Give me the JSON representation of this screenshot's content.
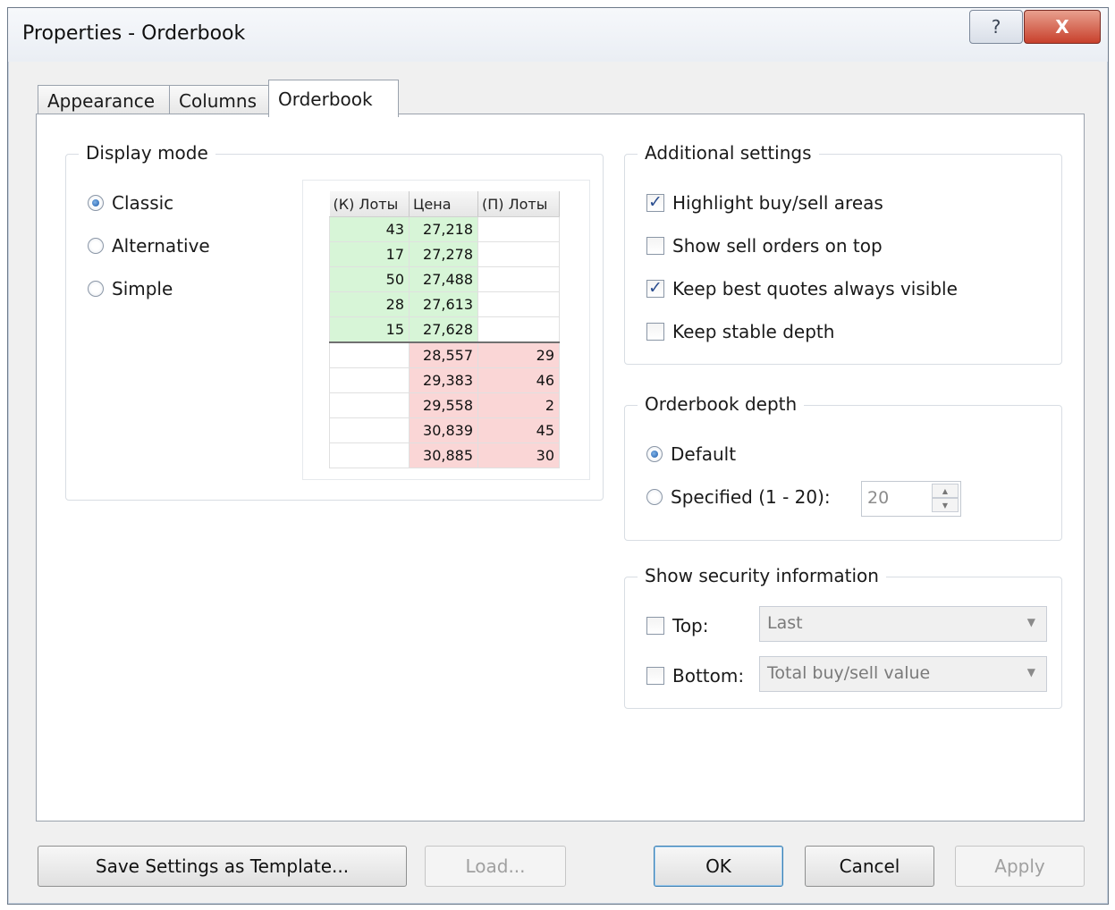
{
  "window": {
    "title": "Properties - Orderbook",
    "help_glyph": "?",
    "close_glyph": "X"
  },
  "tabs": [
    {
      "label": "Appearance",
      "active": false
    },
    {
      "label": "Columns",
      "active": false
    },
    {
      "label": "Orderbook",
      "active": true
    }
  ],
  "display_mode": {
    "title": "Display mode",
    "options": [
      {
        "label": "Classic",
        "selected": true
      },
      {
        "label": "Alternative",
        "selected": false
      },
      {
        "label": "Simple",
        "selected": false
      }
    ],
    "preview": {
      "headers": [
        "(К) Лоты",
        "Цена",
        "(П) Лоты"
      ],
      "buy_rows": [
        [
          "43",
          "27,218",
          ""
        ],
        [
          "17",
          "27,278",
          ""
        ],
        [
          "50",
          "27,488",
          ""
        ],
        [
          "28",
          "27,613",
          ""
        ],
        [
          "15",
          "27,628",
          ""
        ]
      ],
      "sell_rows": [
        [
          "",
          "28,557",
          "29"
        ],
        [
          "",
          "29,383",
          "46"
        ],
        [
          "",
          "29,558",
          "2"
        ],
        [
          "",
          "30,839",
          "45"
        ],
        [
          "",
          "30,885",
          "30"
        ]
      ],
      "buy_color": "#d7f5d7",
      "sell_color": "#fad6d6"
    }
  },
  "additional": {
    "title": "Additional settings",
    "options": [
      {
        "label": "Highlight buy/sell areas",
        "checked": true
      },
      {
        "label": "Show sell orders on top",
        "checked": false
      },
      {
        "label": "Keep best quotes always visible",
        "checked": true
      },
      {
        "label": "Keep stable depth",
        "checked": false
      }
    ]
  },
  "depth": {
    "title": "Orderbook depth",
    "default_label": "Default",
    "default_selected": true,
    "specified_label": "Specified (1 - 20):",
    "specified_selected": false,
    "value": "20"
  },
  "security": {
    "title": "Show security information",
    "top_label": "Top:",
    "top_checked": false,
    "top_value": "Last",
    "bottom_label": "Bottom:",
    "bottom_checked": false,
    "bottom_value": "Total buy/sell value"
  },
  "buttons": {
    "save_template": "Save Settings as Template...",
    "load": "Load...",
    "ok": "OK",
    "cancel": "Cancel",
    "apply": "Apply"
  }
}
